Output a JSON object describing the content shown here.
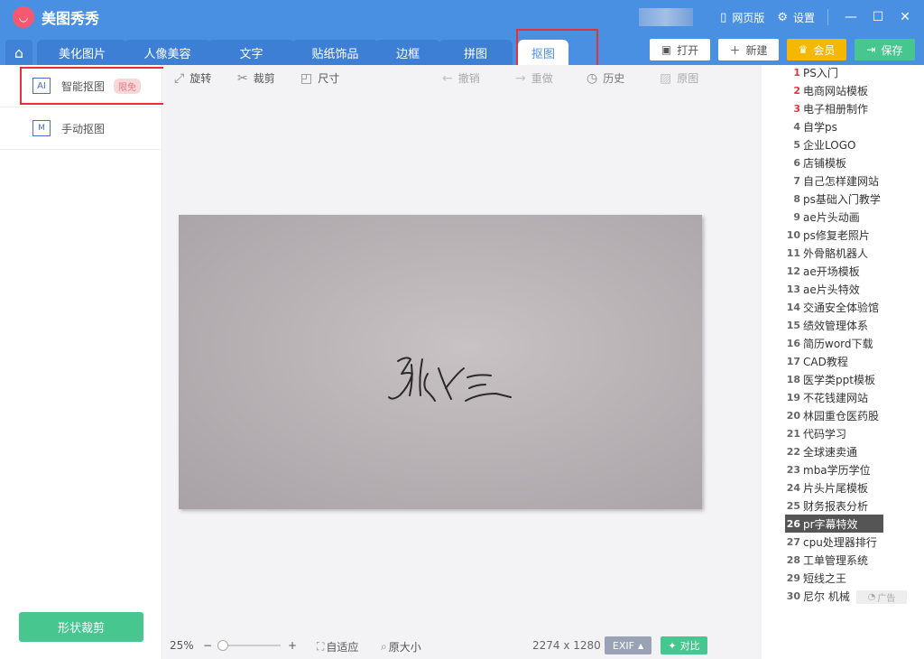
{
  "app": {
    "title": "美图秀秀"
  },
  "titlebar": {
    "web_label": "网页版",
    "settings_label": "设置"
  },
  "tabs": [
    {
      "label": "美化图片"
    },
    {
      "label": "人像美容"
    },
    {
      "label": "文字"
    },
    {
      "label": "贴纸饰品"
    },
    {
      "label": "边框"
    },
    {
      "label": "拼图"
    },
    {
      "label": "抠图"
    }
  ],
  "actions": {
    "open": "打开",
    "new": "新建",
    "vip": "会员",
    "save": "保存"
  },
  "toolbar": {
    "rotate": "旋转",
    "crop": "裁剪",
    "size": "尺寸",
    "undo": "撤销",
    "redo": "重做",
    "history": "历史",
    "original": "原图"
  },
  "left": {
    "smart_cutout": {
      "icon_text": "AI",
      "label": "智能抠图",
      "badge": "限免"
    },
    "manual_cutout": {
      "icon_text": "M",
      "label": "手动抠图"
    },
    "shape_crop": "形状裁剪"
  },
  "canvas": {
    "signature_text": "张三"
  },
  "bottom": {
    "zoom": "25%",
    "zoom_minus": "−",
    "zoom_plus": "+",
    "fit": "自适应",
    "actual": "原大小",
    "dimensions": "2274 x 1280",
    "exif": "EXIF",
    "compare": "对比"
  },
  "trending": [
    {
      "num": "1",
      "text": "PS入门"
    },
    {
      "num": "2",
      "text": "电商网站模板"
    },
    {
      "num": "3",
      "text": "电子相册制作"
    },
    {
      "num": "4",
      "text": "自学ps"
    },
    {
      "num": "5",
      "text": "企业LOGO"
    },
    {
      "num": "6",
      "text": "店铺模板"
    },
    {
      "num": "7",
      "text": "自己怎样建网站"
    },
    {
      "num": "8",
      "text": "ps基础入门教学"
    },
    {
      "num": "9",
      "text": "ae片头动画"
    },
    {
      "num": "10",
      "text": "ps修复老照片"
    },
    {
      "num": "11",
      "text": "外骨骼机器人"
    },
    {
      "num": "12",
      "text": "ae开场模板"
    },
    {
      "num": "13",
      "text": "ae片头特效"
    },
    {
      "num": "14",
      "text": "交通安全体验馆"
    },
    {
      "num": "15",
      "text": "绩效管理体系"
    },
    {
      "num": "16",
      "text": "简历word下载"
    },
    {
      "num": "17",
      "text": "CAD教程"
    },
    {
      "num": "18",
      "text": "医学类ppt模板"
    },
    {
      "num": "19",
      "text": "不花钱建网站"
    },
    {
      "num": "20",
      "text": "林园重仓医药股"
    },
    {
      "num": "21",
      "text": "代码学习"
    },
    {
      "num": "22",
      "text": "全球速卖通"
    },
    {
      "num": "23",
      "text": "mba学历学位"
    },
    {
      "num": "24",
      "text": "片头片尾模板"
    },
    {
      "num": "25",
      "text": "财务报表分析"
    },
    {
      "num": "26",
      "text": "pr字幕特效"
    },
    {
      "num": "27",
      "text": "cpu处理器排行"
    },
    {
      "num": "28",
      "text": "工单管理系统"
    },
    {
      "num": "29",
      "text": "短线之王"
    },
    {
      "num": "30",
      "text": "尼尔 机械"
    }
  ],
  "ad_label": "广告",
  "colors": {
    "primary": "#4a90e2",
    "green": "#48c690",
    "vip": "#f5b800",
    "highlight": "#e5303a"
  }
}
